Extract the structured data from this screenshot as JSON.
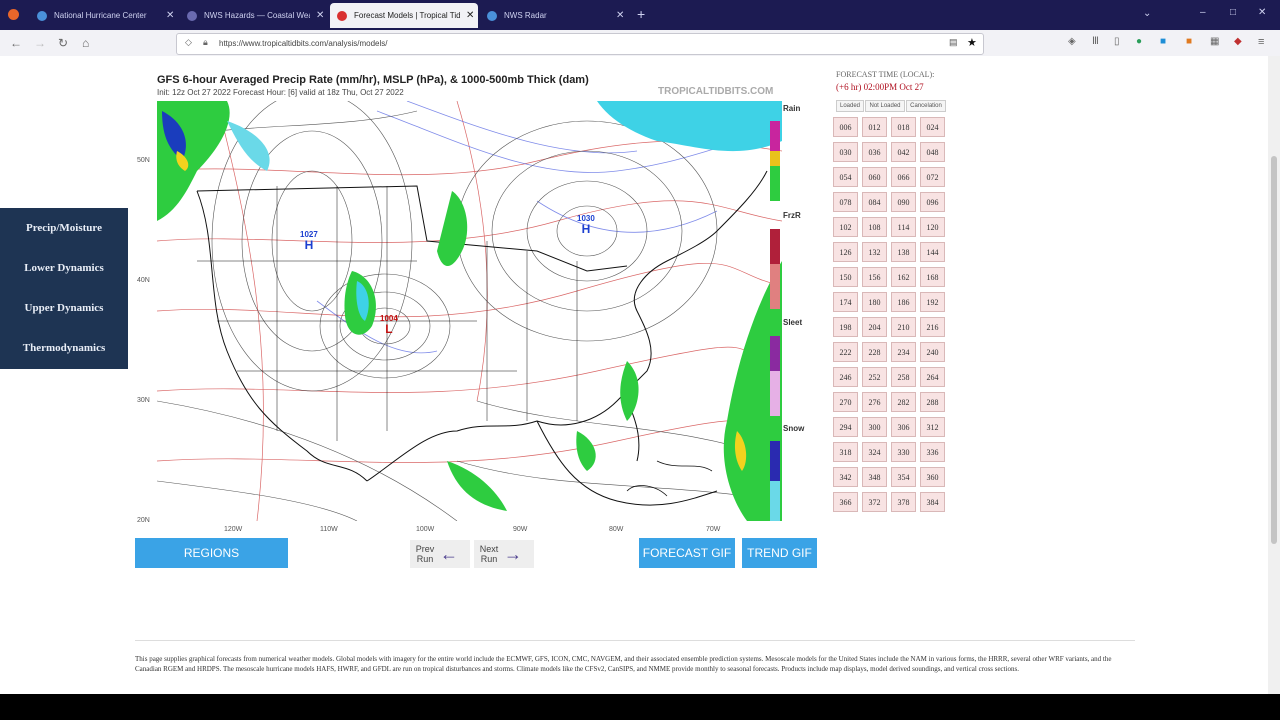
{
  "browser": {
    "tabs": [
      {
        "title": "National Hurricane Center",
        "fav_color": "#4a90d9"
      },
      {
        "title": "NWS Hazards — Coastal Weath",
        "fav_color": "#6a6ab0"
      },
      {
        "title": "Forecast Models | Tropical Tidb",
        "fav_color": "#d93030"
      },
      {
        "title": "NWS Radar",
        "fav_color": "#4a90d9"
      }
    ],
    "new_tab": "+",
    "url": "https://www.tropicaltidbits.com/analysis/models/"
  },
  "sidebar": {
    "items": [
      {
        "label": "Precip/Moisture"
      },
      {
        "label": "Lower Dynamics"
      },
      {
        "label": "Upper Dynamics"
      },
      {
        "label": "Thermodynamics"
      }
    ]
  },
  "map": {
    "title": "GFS 6-hour Averaged Precip Rate (mm/hr), MSLP (hPa), & 1000-500mb Thick (dam)",
    "subtitle": "Init: 12z Oct 27 2022   Forecast Hour: [6]   valid at 18z Thu, Oct 27 2022",
    "watermark": "TROPICALTIDBITS.COM",
    "lat_labels": [
      "50N",
      "40N",
      "30N",
      "20N"
    ],
    "lon_labels": [
      "120W",
      "110W",
      "100W",
      "90W",
      "80W",
      "70W"
    ],
    "legend_labels": [
      "Rain",
      "FrzR",
      "Sleet",
      "Snow"
    ],
    "pressure_centers": [
      {
        "value": "1027",
        "letter": "H"
      },
      {
        "value": "1030",
        "letter": "H"
      },
      {
        "value": "1004",
        "letter": "L"
      }
    ],
    "colors": {
      "ocean": "#ffffff",
      "land_line": "#111111",
      "isobar": "#555555",
      "thickness": "#d04040",
      "precip": "#2ecc40"
    }
  },
  "buttons": {
    "regions": "REGIONS",
    "prev_run": "Prev Run",
    "next_run": "Next Run",
    "forecast_gif": "FORECAST GIF",
    "trend_gif": "TREND GIF"
  },
  "forecast": {
    "header": "FORECAST TIME (LOCAL):",
    "time": "(+6 hr) 02:00PM Oct 27",
    "modes": [
      "Loaded",
      "Not Loaded",
      "Cancelation"
    ],
    "hours": [
      "006",
      "012",
      "018",
      "024",
      "030",
      "036",
      "042",
      "048",
      "054",
      "060",
      "066",
      "072",
      "078",
      "084",
      "090",
      "096",
      "102",
      "108",
      "114",
      "120",
      "126",
      "132",
      "138",
      "144",
      "150",
      "156",
      "162",
      "168",
      "174",
      "180",
      "186",
      "192",
      "198",
      "204",
      "210",
      "216",
      "222",
      "228",
      "234",
      "240",
      "246",
      "252",
      "258",
      "264",
      "270",
      "276",
      "282",
      "288",
      "294",
      "300",
      "306",
      "312",
      "318",
      "324",
      "330",
      "336",
      "342",
      "348",
      "354",
      "360",
      "366",
      "372",
      "378",
      "384"
    ]
  },
  "footer": "This page supplies graphical forecasts from numerical weather models. Global models with imagery for the entire world include the ECMWF, GFS, ICON, CMC, NAVGEM, and their associated ensemble prediction systems. Mesoscale models for the United States include the NAM in various forms, the HRRR, several other WRF variants, and the Canadian RGEM and HRDPS. The mesoscale hurricane models HAFS, HWRF, and GFDL are run on tropical disturbances and storms. Climate models like the CFSv2, CanSIPS, and NMME provide monthly to seasonal forecasts. Products include map displays, model derived soundings, and vertical cross sections."
}
